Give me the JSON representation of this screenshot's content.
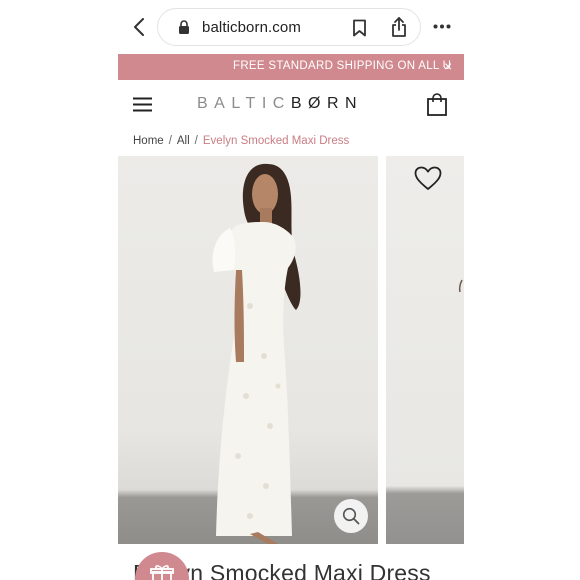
{
  "browser": {
    "url": "balticborn.com",
    "icons": [
      "back-icon",
      "lock-icon",
      "bookmark-icon",
      "share-icon",
      "more-icon"
    ]
  },
  "promo": {
    "text": "FREE STANDARD SHIPPING ON ALL U",
    "close": "×"
  },
  "header": {
    "logo_part1": "BALTIC",
    "logo_part2": "BØRN"
  },
  "breadcrumb": {
    "home": "Home",
    "all": "All",
    "current": "Evelyn Smocked Maxi Dress",
    "separator": "/"
  },
  "product": {
    "title": "Evelyn Smocked Maxi Dress"
  },
  "colors": {
    "accent": "#d08a8f",
    "breadcrumb_current": "#c97d83"
  }
}
